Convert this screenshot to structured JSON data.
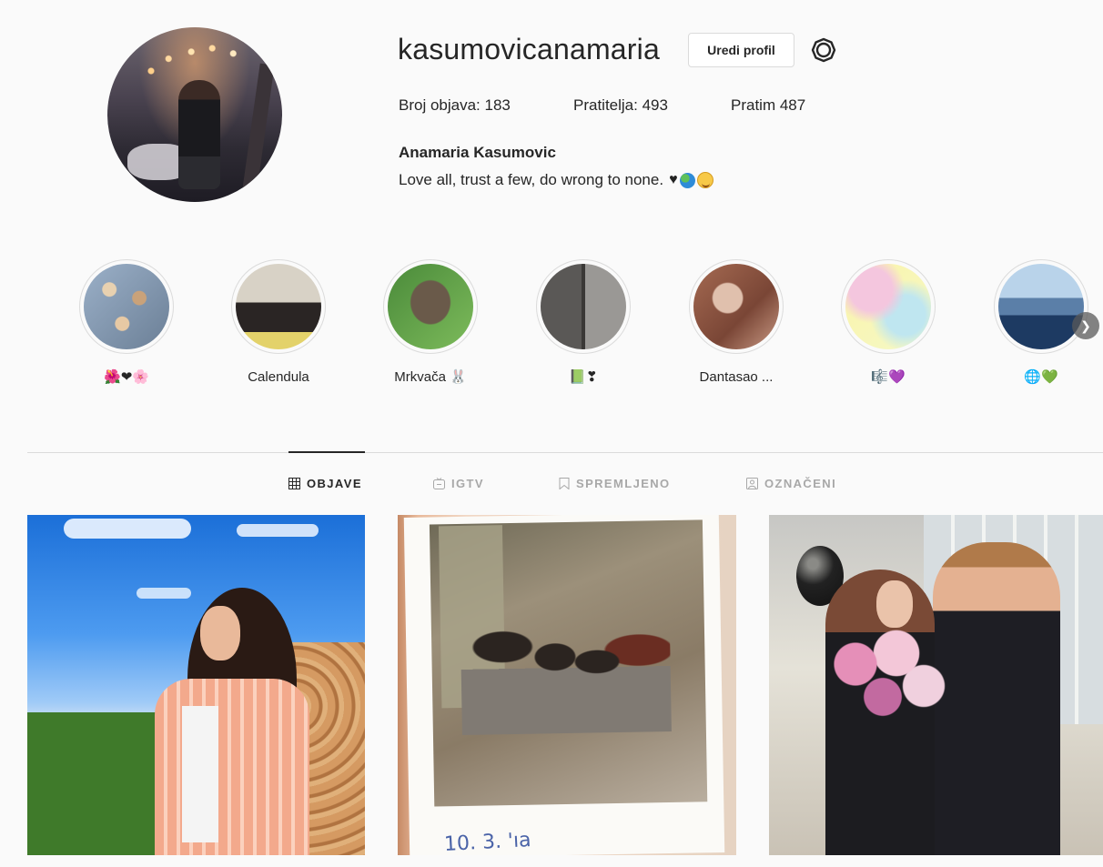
{
  "profile": {
    "username": "kasumovicanamaria",
    "edit_label": "Uredi profil",
    "stats": {
      "posts": "Broj objava: 183",
      "followers": "Pratitelja: 493",
      "following": "Pratim 487"
    },
    "full_name": "Anamaria Kasumovic",
    "bio": "Love all, trust a few, do wrong to none."
  },
  "highlights": [
    {
      "label": "🌺❤🌸",
      "colors": [
        "#9bb0c8",
        "#c9a27a"
      ]
    },
    {
      "label": "Calendula",
      "colors": [
        "#d8d2c6",
        "#2a2524"
      ]
    },
    {
      "label": "Mrkvača 🐰",
      "colors": [
        "#4a8a3a",
        "#6a5a4a"
      ]
    },
    {
      "label": "📗❣",
      "colors": [
        "#5a5856",
        "#9a9895"
      ]
    },
    {
      "label": "Dantasao ...",
      "colors": [
        "#a56a52",
        "#e0c0ad"
      ]
    },
    {
      "label": "🎼💜",
      "colors": [
        "#fbf3a8",
        "#f4c6de"
      ]
    },
    {
      "label": "🌐💚",
      "colors": [
        "#5b7fa8",
        "#1d3a62"
      ]
    }
  ],
  "tabs": [
    {
      "label": "OBJAVE",
      "icon": "grid-icon",
      "active": true
    },
    {
      "label": "IGTV",
      "icon": "igtv-icon",
      "active": false
    },
    {
      "label": "SPREMLJENO",
      "icon": "bookmark-icon",
      "active": false
    },
    {
      "label": "OZNAČENI",
      "icon": "tagged-icon",
      "active": false
    }
  ],
  "posts": [
    {
      "caption": ""
    },
    {
      "caption": "10. 3. 'ıa"
    },
    {
      "caption": ""
    }
  ],
  "colors": {
    "background": "#fafafa",
    "text": "#262626",
    "muted": "#a8a8a8",
    "border": "#dbdbdb"
  }
}
